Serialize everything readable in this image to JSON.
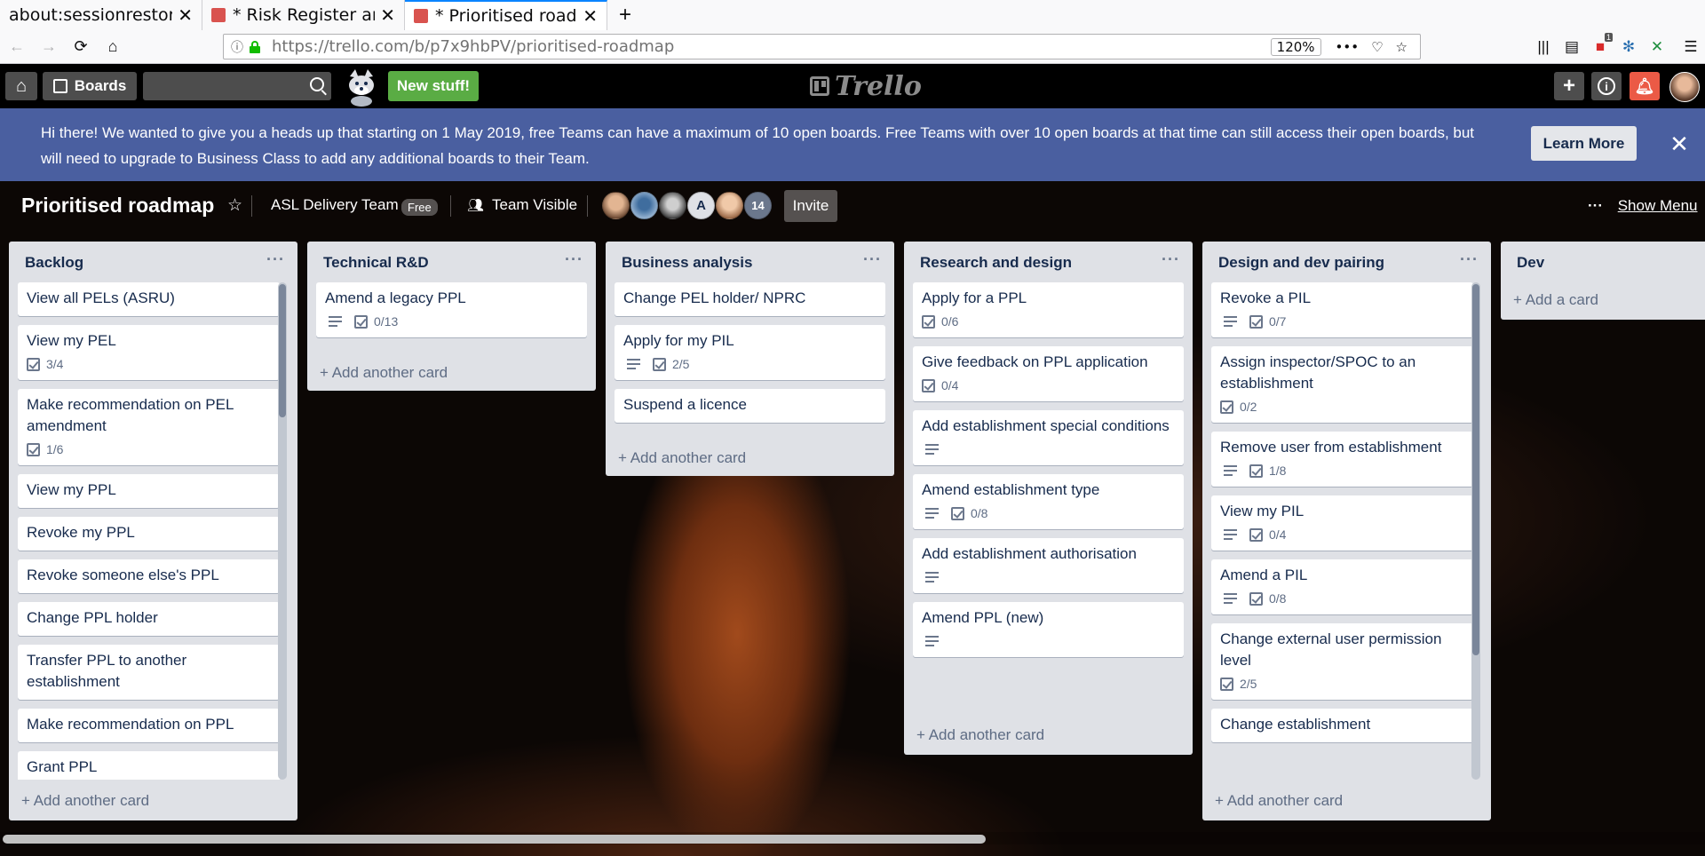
{
  "browser": {
    "tabs": [
      {
        "title": "about:sessionrestore",
        "favicon_color": "#ffffff"
      },
      {
        "title": "* Risk Register and",
        "favicon_color": "#d9534f"
      },
      {
        "title": "* Prioritised roadm",
        "favicon_color": "#d9534f"
      }
    ],
    "url": "https://trello.com/b/p7x9hbPV/prioritised-roadmap",
    "zoom": "120%",
    "notification_count": "1"
  },
  "header": {
    "boards_label": "Boards",
    "new_stuff_label": "New stuff!",
    "logo_text": "Trello"
  },
  "banner": {
    "message": "Hi there! We wanted to give you a heads up that starting on 1 May 2019, free Teams can have a maximum of 10 open boards. Free Teams with over 10 open boards at that time can still access their open boards, but will need to upgrade to Business Class to add any additional boards to their Team.",
    "learn_more": "Learn More"
  },
  "board": {
    "title": "Prioritised roadmap",
    "team": "ASL Delivery Team",
    "team_badge": "Free",
    "visibility": "Team Visible",
    "member_initial": "A",
    "member_count": "14",
    "invite": "Invite",
    "show_menu": "Show Menu"
  },
  "lists": [
    {
      "name": "Backlog",
      "add": "Add another card",
      "cards": [
        {
          "title": "View all PELs (ASRU)"
        },
        {
          "title": "View my PEL",
          "checklist": "3/4"
        },
        {
          "title": "Make recommendation on PEL amendment",
          "checklist": "1/6"
        },
        {
          "title": "View my PPL"
        },
        {
          "title": "Revoke my PPL"
        },
        {
          "title": "Revoke someone else's PPL"
        },
        {
          "title": "Change PPL holder"
        },
        {
          "title": "Transfer PPL to another establishment"
        },
        {
          "title": "Make recommendation on PPL"
        },
        {
          "title": "Grant PPL"
        }
      ]
    },
    {
      "name": "Technical R&D",
      "add": "Add another card",
      "cards": [
        {
          "title": "Amend a legacy PPL",
          "desc": true,
          "checklist": "0/13"
        }
      ]
    },
    {
      "name": "Business analysis",
      "add": "Add another card",
      "cards": [
        {
          "title": "Change PEL holder/ NPRC"
        },
        {
          "title": "Apply for my PIL",
          "desc": true,
          "checklist": "2/5"
        },
        {
          "title": "Suspend a licence"
        }
      ]
    },
    {
      "name": "Research and design",
      "add": "Add another card",
      "cards": [
        {
          "title": "Apply for a PPL",
          "checklist": "0/6"
        },
        {
          "title": "Give feedback on PPL application",
          "checklist": "0/4"
        },
        {
          "title": "Add establishment special conditions",
          "desc": true
        },
        {
          "title": "Amend establishment type",
          "desc": true,
          "checklist": "0/8"
        },
        {
          "title": "Add establishment authorisation",
          "desc": true
        },
        {
          "title": "Amend PPL (new)",
          "desc": true
        }
      ]
    },
    {
      "name": "Design and dev pairing",
      "add": "Add another card",
      "cards": [
        {
          "title": "Revoke a PIL",
          "desc": true,
          "checklist": "0/7"
        },
        {
          "title": "Assign inspector/SPOC to an establishment",
          "checklist": "0/2"
        },
        {
          "title": "Remove user from establishment",
          "desc": true,
          "checklist": "1/8"
        },
        {
          "title": "View my PIL",
          "desc": true,
          "checklist": "0/4"
        },
        {
          "title": "Amend a PIL",
          "desc": true,
          "checklist": "0/8"
        },
        {
          "title": "Change external user permission level",
          "checklist": "2/5"
        },
        {
          "title": "Change establishment"
        }
      ]
    },
    {
      "name": "Dev",
      "add": "Add a card",
      "cards": []
    }
  ]
}
